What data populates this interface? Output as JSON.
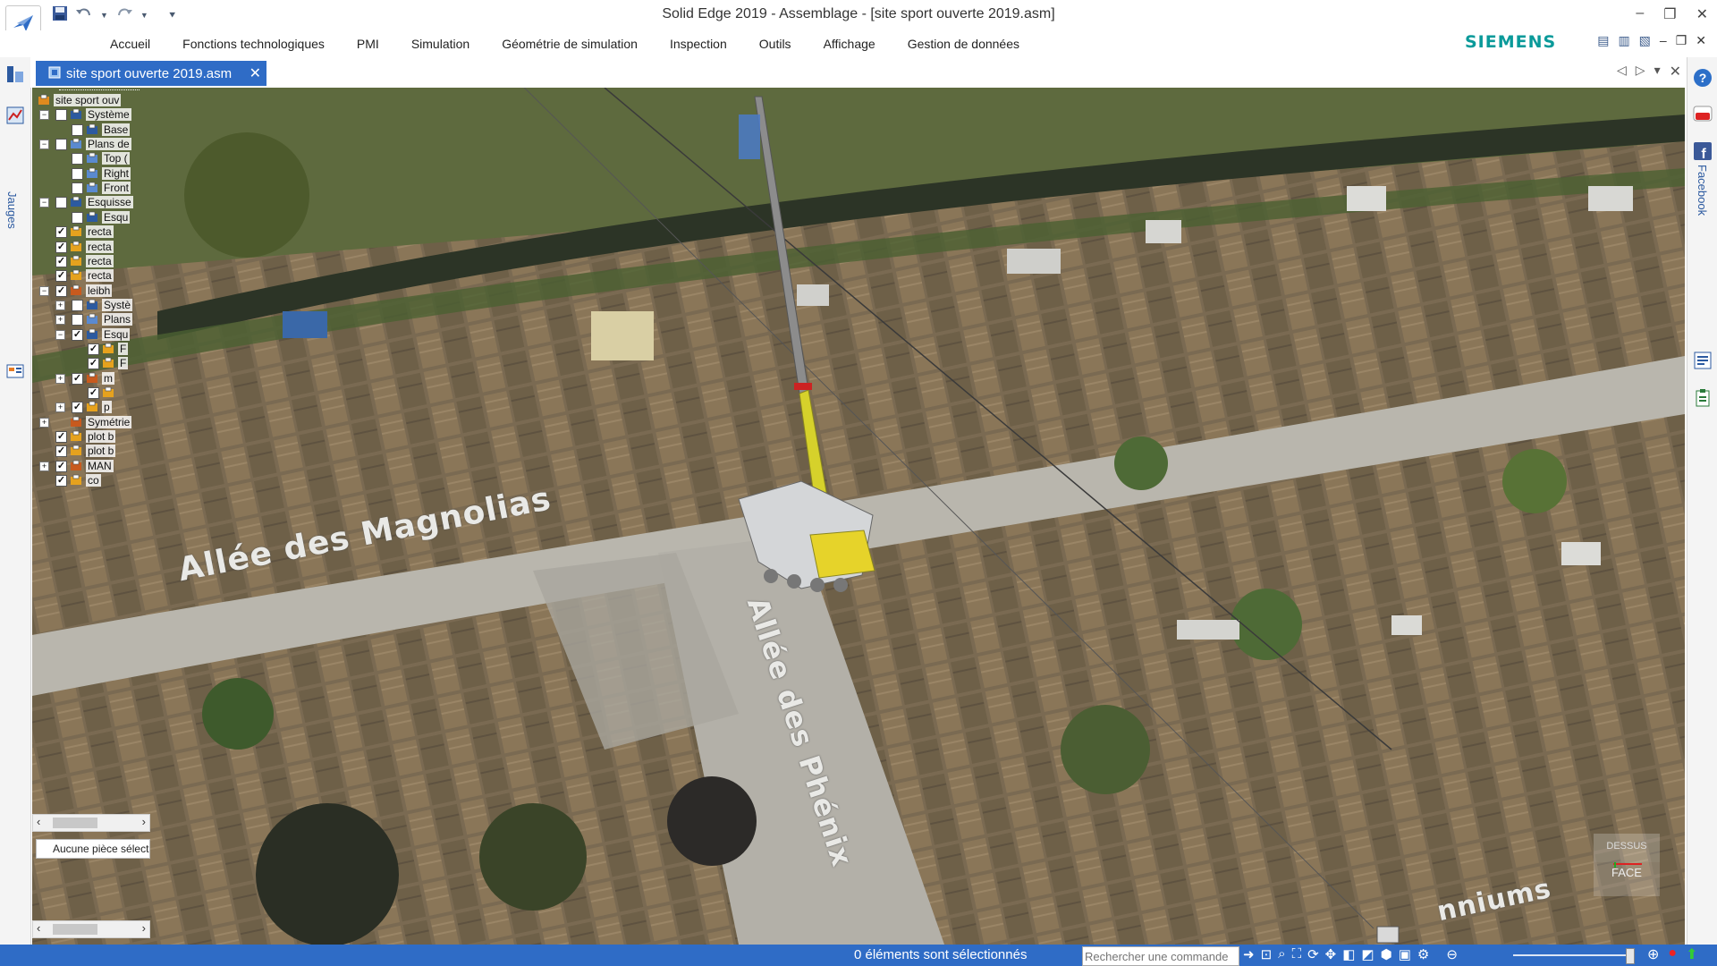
{
  "window": {
    "title": "Solid Edge 2019 - Assemblage - [site sport ouverte 2019.asm]",
    "controls": [
      "–",
      "❐",
      "✕"
    ]
  },
  "quick_access": {
    "save_icon": "save-icon",
    "undo_icon": "undo-icon",
    "redo_icon": "redo-icon",
    "customize_icon": "customize-icon"
  },
  "ribbon": {
    "tabs": [
      "Accueil",
      "Fonctions technologiques",
      "PMI",
      "Simulation",
      "Géométrie de simulation",
      "Inspection",
      "Outils",
      "Affichage",
      "Gestion de données"
    ],
    "brand": "SIEMENS",
    "brand_color": "#0a9a9a"
  },
  "document_tab": {
    "label": "site sport ouverte 2019.asm",
    "close": "✕",
    "accent": "#2f6cc6"
  },
  "left_strip": {
    "jauges_label": "Jauges"
  },
  "right_strip": {
    "facebook_label": "Facebook"
  },
  "pathfinder": {
    "rows": [
      {
        "label": "site sport ouv",
        "level": 0,
        "expander": "",
        "check": "",
        "icon": "assembly-icon"
      },
      {
        "label": "Système",
        "level": 1,
        "expander": "−",
        "check": " ",
        "icon": "coordinate-system-icon"
      },
      {
        "label": "Base",
        "level": 2,
        "expander": "",
        "check": " ",
        "icon": "coordinate-system-icon"
      },
      {
        "label": "Plans de",
        "level": 1,
        "expander": "−",
        "check": " ",
        "icon": "plane-icon"
      },
      {
        "label": "Top (",
        "level": 2,
        "expander": "",
        "check": " ",
        "icon": "plane-icon"
      },
      {
        "label": "Right",
        "level": 2,
        "expander": "",
        "check": " ",
        "icon": "plane-icon"
      },
      {
        "label": "Front",
        "level": 2,
        "expander": "",
        "check": " ",
        "icon": "plane-icon"
      },
      {
        "label": "Esquisse",
        "level": 1,
        "expander": "−",
        "check": " ",
        "icon": "sketch-icon"
      },
      {
        "label": "Esqu",
        "level": 2,
        "expander": "",
        "check": " ",
        "icon": "sketch-icon"
      },
      {
        "label": "recta",
        "level": 1,
        "expander": "",
        "check": "✓",
        "icon": "part-icon"
      },
      {
        "label": "recta",
        "level": 1,
        "expander": "",
        "check": "✓",
        "icon": "part-icon"
      },
      {
        "label": "recta",
        "level": 1,
        "expander": "",
        "check": "✓",
        "icon": "part-icon"
      },
      {
        "label": "recta",
        "level": 1,
        "expander": "",
        "check": "✓",
        "icon": "part-icon"
      },
      {
        "label": "leibh",
        "level": 1,
        "expander": "−",
        "check": "✓",
        "icon": "subassembly-icon"
      },
      {
        "label": "Systè",
        "level": 2,
        "expander": "+",
        "check": " ",
        "icon": "coordinate-system-icon"
      },
      {
        "label": "Plans",
        "level": 2,
        "expander": "+",
        "check": " ",
        "icon": "plane-icon"
      },
      {
        "label": "Esqu",
        "level": 2,
        "expander": "−",
        "check": "✓",
        "icon": "sketch-icon"
      },
      {
        "label": "F",
        "level": 3,
        "expander": "",
        "check": "✓",
        "icon": "part-icon"
      },
      {
        "label": "F",
        "level": 3,
        "expander": "",
        "check": "✓",
        "icon": "part-icon"
      },
      {
        "label": "m",
        "level": 2,
        "expander": "+",
        "check": "✓",
        "icon": "subassembly-icon"
      },
      {
        "label": "",
        "level": 3,
        "expander": "",
        "check": "✓",
        "icon": "part-icon"
      },
      {
        "label": "p",
        "level": 2,
        "expander": "+",
        "check": "✓",
        "icon": "part-icon"
      },
      {
        "label": "Symétrie",
        "level": 1,
        "expander": "+",
        "check": "",
        "icon": "mirror-icon"
      },
      {
        "label": "plot b",
        "level": 1,
        "expander": "",
        "check": "✓",
        "icon": "part-icon"
      },
      {
        "label": "plot b",
        "level": 1,
        "expander": "",
        "check": "✓",
        "icon": "part-icon"
      },
      {
        "label": "MAN",
        "level": 1,
        "expander": "+",
        "check": "✓",
        "icon": "subassembly-icon"
      },
      {
        "label": "co",
        "level": 1,
        "expander": "",
        "check": "✓",
        "icon": "part-icon"
      }
    ],
    "scroll_left": "‹",
    "scroll_right": "›",
    "selection_message": "Aucune pièce sélectionnée"
  },
  "viewport": {
    "streets": [
      "Allée des Magnolias",
      "Allée des Phénix",
      "nniums"
    ],
    "view_cube_top": "DESSUS",
    "view_cube_face": "FACE"
  },
  "status_bar": {
    "selection_text": "0 éléments sont sélectionnés",
    "command_placeholder": "Rechercher une commande",
    "accent": "#2f6cc6"
  }
}
